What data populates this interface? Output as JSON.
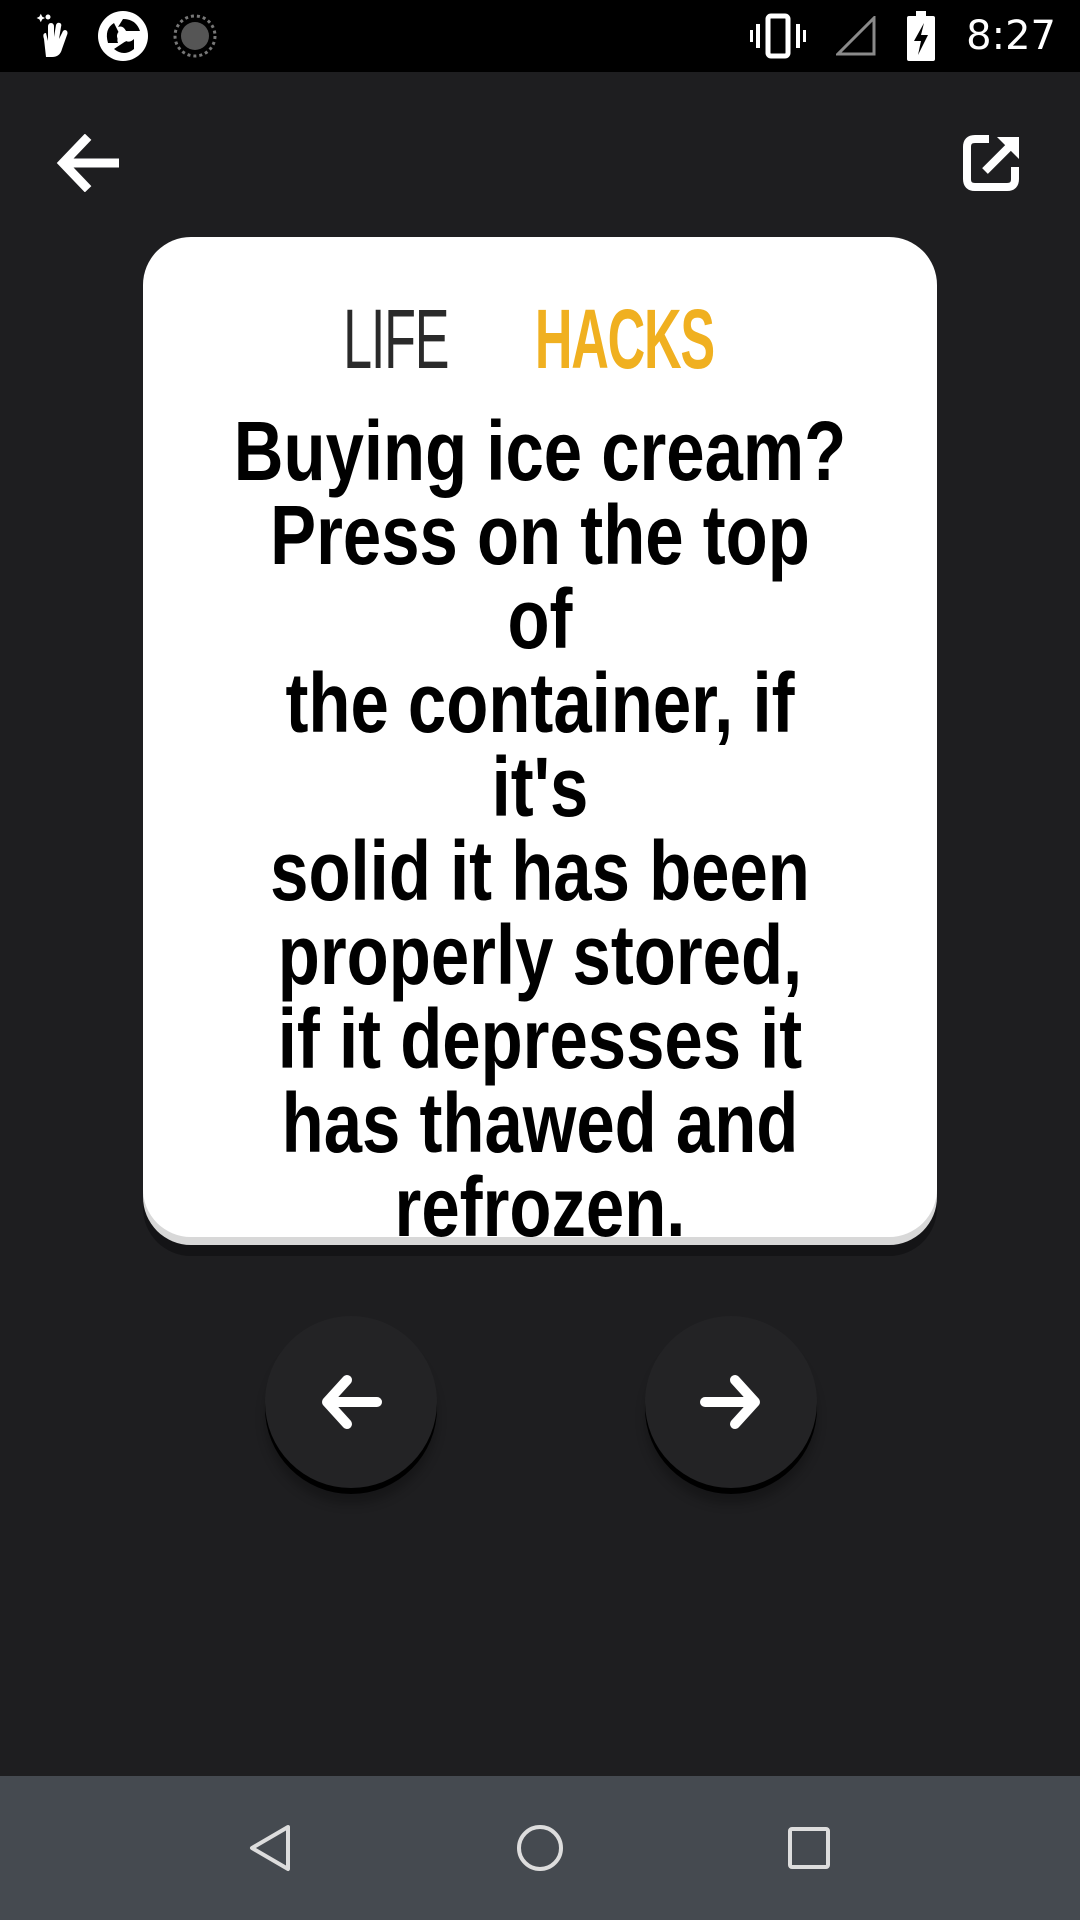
{
  "status_bar": {
    "time": "8:27",
    "icons": [
      "clean-hand-icon",
      "browser-circle-icon",
      "loading-spinner-icon",
      "vibrate-icon",
      "signal-icon",
      "battery-charging-icon"
    ]
  },
  "top_bar": {
    "back_icon": "arrow-left-icon",
    "share_icon": "share-external-icon"
  },
  "card": {
    "brand_part1": "LIFE",
    "brand_part2": "HACKS",
    "text": "Buying ice cream?\nPress on the top of\nthe container, if it's\nsolid it has been\nproperly stored,\nif it depresses it\nhas thawed and\nrefrozen."
  },
  "navigation": {
    "prev_icon": "arrow-left-icon",
    "next_icon": "arrow-right-icon"
  },
  "system_nav": {
    "icons": [
      "triangle-back-icon",
      "circle-home-icon",
      "square-recents-icon"
    ]
  },
  "colors": {
    "background": "#1e1e20",
    "card": "#ffffff",
    "brand_accent": "#f0b020",
    "nav_bar": "#454a50"
  }
}
